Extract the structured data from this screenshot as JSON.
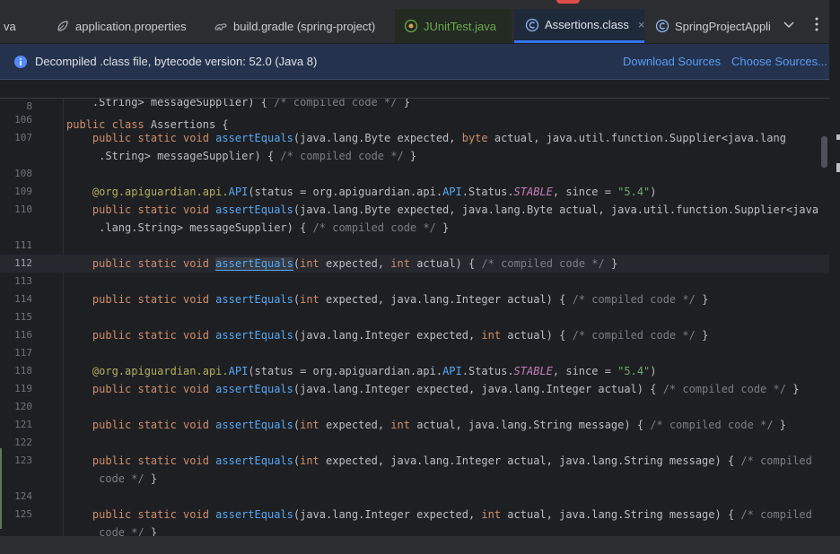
{
  "tabs": [
    {
      "label": "va",
      "icon": "java-file-icon"
    },
    {
      "label": "application.properties",
      "icon": "spring-leaf-icon"
    },
    {
      "label": "build.gradle (spring-project)",
      "icon": "gradle-icon"
    },
    {
      "label": "JUnitTest.java",
      "icon": "java-class-icon"
    },
    {
      "label": "Assertions.class",
      "icon": "class-file-icon",
      "close": "×"
    },
    {
      "label": "SpringProjectApplic",
      "icon": "java-class-icon"
    }
  ],
  "banner": {
    "message": "Decompiled .class file, bytecode version: 52.0 (Java 8)",
    "download_sources": "Download Sources",
    "choose_sources": "Choose Sources..."
  },
  "sticky": {
    "line": "8",
    "text": "public class Assertions {"
  },
  "lines": [
    {
      "n": "",
      "seg": [
        {
          "t": "    .String> messageSupplier) { "
        },
        {
          "t": "/* compiled code */",
          "c": "cm"
        },
        {
          "t": " }"
        }
      ]
    },
    {
      "n": "106",
      "seg": []
    },
    {
      "n": "107",
      "seg": [
        {
          "t": "    public static void ",
          "c": "kw"
        },
        {
          "t": "assertEquals",
          "c": "fn"
        },
        {
          "t": "(java.lang.Byte expected, "
        },
        {
          "t": "byte",
          "c": "kw"
        },
        {
          "t": " actual, java.util.function.Supplier<java.lang"
        }
      ]
    },
    {
      "n": "",
      "seg": [
        {
          "t": "     .String> messageSupplier) { "
        },
        {
          "t": "/* compiled code */",
          "c": "cm"
        },
        {
          "t": " }"
        }
      ]
    },
    {
      "n": "108",
      "seg": []
    },
    {
      "n": "109",
      "seg": [
        {
          "t": "    @org.apiguardian.api.",
          "c": "an"
        },
        {
          "t": "API",
          "c": "fn"
        },
        {
          "t": "(status = org.apiguardian.api."
        },
        {
          "t": "API",
          "c": "fn"
        },
        {
          "t": ".Status."
        },
        {
          "t": "STABLE",
          "c": "it"
        },
        {
          "t": ", since = "
        },
        {
          "t": "\"5.4\"",
          "c": "st"
        },
        {
          "t": ")"
        }
      ]
    },
    {
      "n": "110",
      "seg": [
        {
          "t": "    public static void ",
          "c": "kw"
        },
        {
          "t": "assertEquals",
          "c": "fn"
        },
        {
          "t": "(java.lang.Byte expected, java.lang.Byte actual, java.util.function.Supplier<java"
        }
      ]
    },
    {
      "n": "",
      "seg": [
        {
          "t": "     .lang.String> messageSupplier) { "
        },
        {
          "t": "/* compiled code */",
          "c": "cm"
        },
        {
          "t": " }"
        }
      ]
    },
    {
      "n": "111",
      "seg": []
    },
    {
      "n": "112",
      "current": true,
      "seg": [
        {
          "t": "    public static void ",
          "c": "kw"
        },
        {
          "t": "assertEquals",
          "c": "fn hl"
        },
        {
          "t": "("
        },
        {
          "t": "int",
          "c": "kw"
        },
        {
          "t": " expected, "
        },
        {
          "t": "int",
          "c": "kw"
        },
        {
          "t": " actual) { "
        },
        {
          "t": "/* compiled code */",
          "c": "cm"
        },
        {
          "t": " }"
        }
      ]
    },
    {
      "n": "113",
      "seg": []
    },
    {
      "n": "114",
      "seg": [
        {
          "t": "    public static void ",
          "c": "kw"
        },
        {
          "t": "assertEquals",
          "c": "fn"
        },
        {
          "t": "("
        },
        {
          "t": "int",
          "c": "kw"
        },
        {
          "t": " expected, java.lang.Integer actual) { "
        },
        {
          "t": "/* compiled code */",
          "c": "cm"
        },
        {
          "t": " }"
        }
      ]
    },
    {
      "n": "115",
      "seg": []
    },
    {
      "n": "116",
      "seg": [
        {
          "t": "    public static void ",
          "c": "kw"
        },
        {
          "t": "assertEquals",
          "c": "fn"
        },
        {
          "t": "(java.lang.Integer expected, "
        },
        {
          "t": "int",
          "c": "kw"
        },
        {
          "t": " actual) { "
        },
        {
          "t": "/* compiled code */",
          "c": "cm"
        },
        {
          "t": " }"
        }
      ]
    },
    {
      "n": "117",
      "seg": []
    },
    {
      "n": "118",
      "seg": [
        {
          "t": "    @org.apiguardian.api.",
          "c": "an"
        },
        {
          "t": "API",
          "c": "fn"
        },
        {
          "t": "(status = org.apiguardian.api."
        },
        {
          "t": "API",
          "c": "fn"
        },
        {
          "t": ".Status."
        },
        {
          "t": "STABLE",
          "c": "it"
        },
        {
          "t": ", since = "
        },
        {
          "t": "\"5.4\"",
          "c": "st"
        },
        {
          "t": ")"
        }
      ]
    },
    {
      "n": "119",
      "seg": [
        {
          "t": "    public static void ",
          "c": "kw"
        },
        {
          "t": "assertEquals",
          "c": "fn"
        },
        {
          "t": "(java.lang.Integer expected, java.lang.Integer actual) { "
        },
        {
          "t": "/* compiled code */",
          "c": "cm"
        },
        {
          "t": " }"
        }
      ]
    },
    {
      "n": "120",
      "seg": []
    },
    {
      "n": "121",
      "seg": [
        {
          "t": "    public static void ",
          "c": "kw"
        },
        {
          "t": "assertEquals",
          "c": "fn"
        },
        {
          "t": "("
        },
        {
          "t": "int",
          "c": "kw"
        },
        {
          "t": " expected, "
        },
        {
          "t": "int",
          "c": "kw"
        },
        {
          "t": " actual, java.lang.String message) { "
        },
        {
          "t": "/* compiled code */",
          "c": "cm"
        },
        {
          "t": " }"
        }
      ]
    },
    {
      "n": "122",
      "seg": []
    },
    {
      "n": "123",
      "seg": [
        {
          "t": "    public static void ",
          "c": "kw"
        },
        {
          "t": "assertEquals",
          "c": "fn"
        },
        {
          "t": "("
        },
        {
          "t": "int",
          "c": "kw"
        },
        {
          "t": " expected, java.lang.Integer actual, java.lang.String message) { "
        },
        {
          "t": "/* compiled",
          "c": "cm"
        }
      ]
    },
    {
      "n": "",
      "seg": [
        {
          "t": "     code */",
          "c": "cm"
        },
        {
          "t": " }"
        }
      ]
    },
    {
      "n": "124",
      "seg": []
    },
    {
      "n": "125",
      "seg": [
        {
          "t": "    public static void ",
          "c": "kw"
        },
        {
          "t": "assertEquals",
          "c": "fn"
        },
        {
          "t": "(java.lang.Integer expected, "
        },
        {
          "t": "int",
          "c": "kw"
        },
        {
          "t": " actual, java.lang.String message) { "
        },
        {
          "t": "/* compiled",
          "c": "cm"
        }
      ]
    },
    {
      "n": "",
      "seg": [
        {
          "t": "     code */",
          "c": "cm"
        },
        {
          "t": " }"
        }
      ]
    }
  ],
  "colors": {
    "accent": "#3574f0",
    "keyword": "#cf8e6d",
    "method": "#56a8f5",
    "comment": "#7a7e85",
    "string": "#6aab73"
  }
}
